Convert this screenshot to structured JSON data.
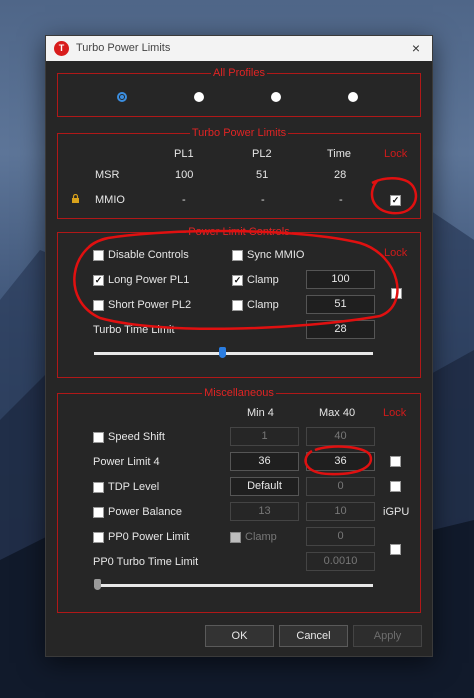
{
  "window": {
    "title": "Turbo Power Limits",
    "close_glyph": "×",
    "icon_letter": "T"
  },
  "all_profiles": {
    "title": "All Profiles",
    "selected_index": 0,
    "count": 4
  },
  "turbo_power_limits": {
    "title": "Turbo Power Limits",
    "columns": [
      "PL1",
      "PL2",
      "Time"
    ],
    "lock_label": "Lock",
    "rows": [
      {
        "label": "MSR",
        "pl1": "100",
        "pl2": "51",
        "time": "28"
      },
      {
        "label": "MMIO",
        "pl1": "-",
        "pl2": "-",
        "time": "-",
        "locked": true,
        "lock_checked": true
      }
    ]
  },
  "power_limit_controls": {
    "title": "Power Limit Controls",
    "lock_label": "Lock",
    "disable_controls": {
      "label": "Disable Controls",
      "checked": false
    },
    "sync_mmio": {
      "label": "Sync MMIO",
      "checked": false
    },
    "long_power": {
      "label": "Long Power PL1",
      "checked": true
    },
    "long_clamp": {
      "label": "Clamp",
      "checked": true,
      "value": "100"
    },
    "short_power": {
      "label": "Short Power PL2",
      "checked": false
    },
    "short_clamp": {
      "label": "Clamp",
      "checked": false,
      "value": "51"
    },
    "turbo_time": {
      "label": "Turbo Time Limit",
      "value": "28"
    },
    "slider_fraction": 0.46,
    "lock_checked": false
  },
  "miscellaneous": {
    "title": "Miscellaneous",
    "min_label": "Min  4",
    "max_label": "Max  40",
    "lock_label": "Lock",
    "speed_shift": {
      "label": "Speed Shift",
      "min": "1",
      "max": "40",
      "checked": false
    },
    "power_limit_4": {
      "label": "Power Limit 4",
      "min": "36",
      "max": "36",
      "lock_checked": false
    },
    "tdp_level": {
      "label": "TDP Level",
      "min": "Default",
      "max": "0",
      "checked": false,
      "lock_checked": false
    },
    "power_balance": {
      "label": "Power Balance",
      "min": "13",
      "max": "10",
      "checked": false,
      "extra": "iGPU"
    },
    "pp0_power_limit": {
      "label": "PP0 Power Limit",
      "clamp_label": "Clamp",
      "value": "0",
      "checked": false,
      "lock_checked": false
    },
    "pp0_turbo_time": {
      "label": "PP0 Turbo Time Limit",
      "value": "0.0010"
    },
    "slider_fraction": 0.0
  },
  "buttons": {
    "ok": "OK",
    "cancel": "Cancel",
    "apply": "Apply"
  },
  "colors": {
    "accent_red": "#d01b1b",
    "selected_blue": "#3b8ee0",
    "thumb_blue": "#2a7de1",
    "thumb_gray": "#9a9a9a"
  }
}
